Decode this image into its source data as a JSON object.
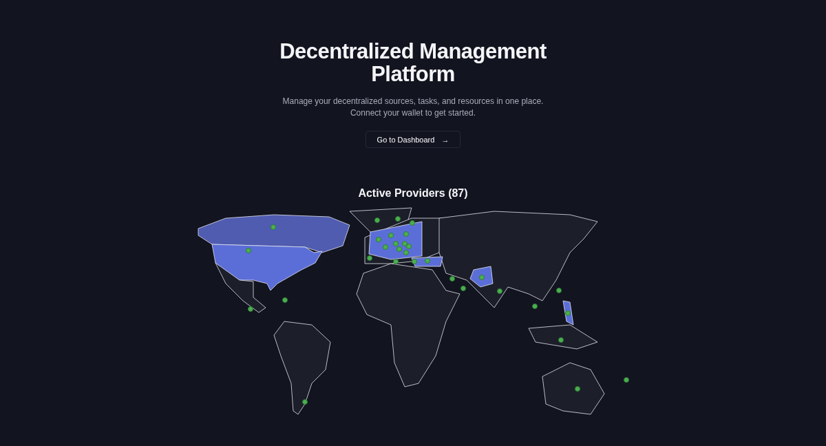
{
  "hero": {
    "title": "Decentralized Management Platform",
    "subtitle": "Manage your decentralized sources, tasks, and resources in one place. Connect your wallet to get started.",
    "button": {
      "label": "Go to Dashboard",
      "icon": "→"
    }
  },
  "providers": {
    "title": "Active Providers (87)"
  }
}
